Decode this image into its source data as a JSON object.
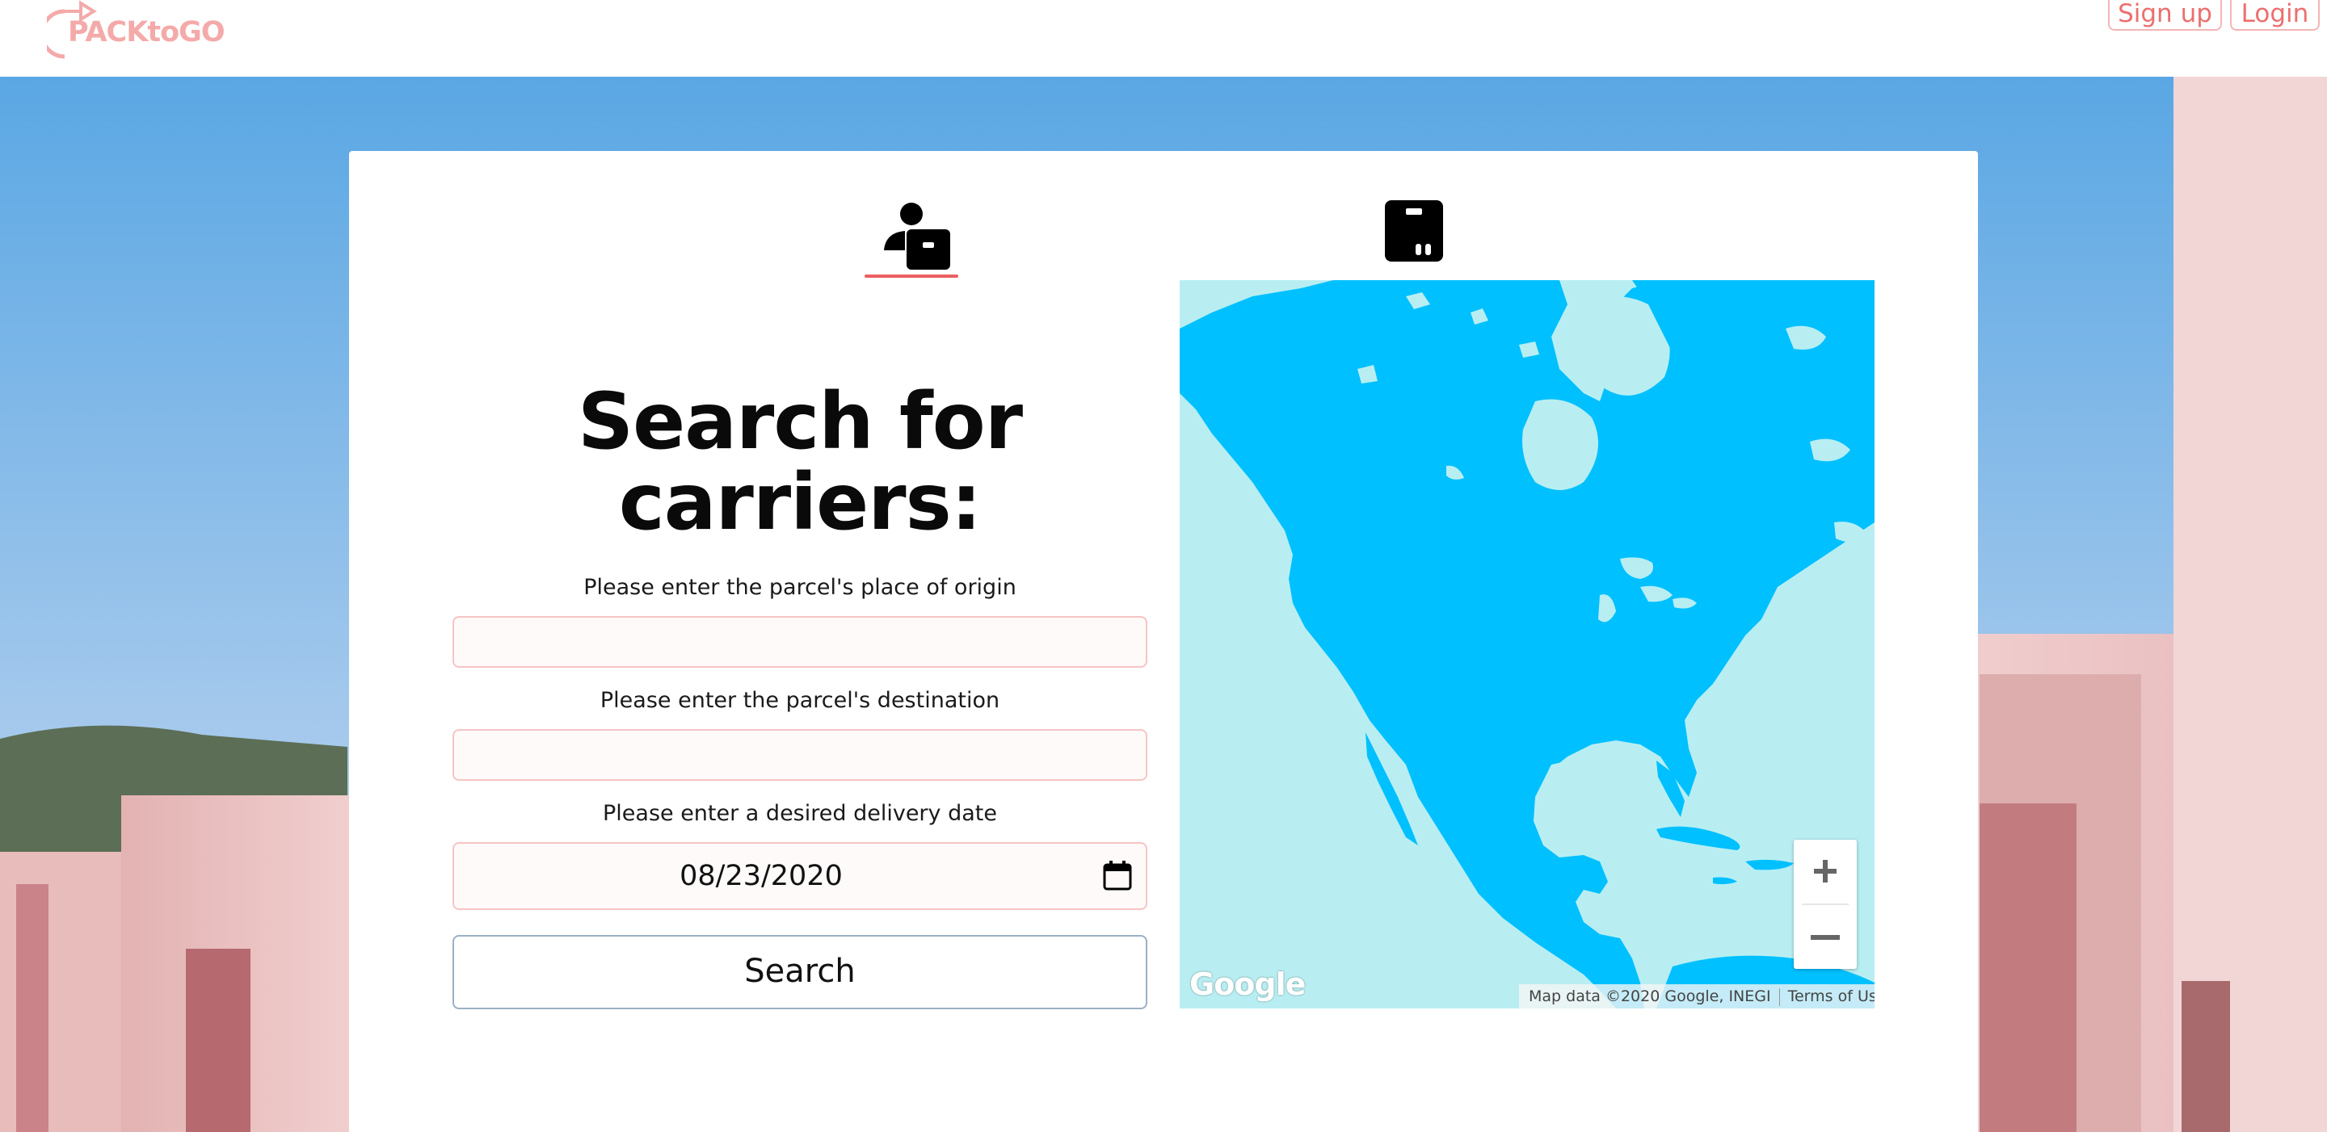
{
  "header": {
    "logo_text": "PACKtoGO",
    "signup_label": "Sign up",
    "login_label": "Login"
  },
  "tabs": [
    {
      "name": "carrier",
      "icon": "carrier-person-icon",
      "active": true
    },
    {
      "name": "parcel",
      "icon": "parcel-box-icon",
      "active": false
    }
  ],
  "form": {
    "title": "Search for carriers:",
    "origin_label": "Please enter the parcel's place of origin",
    "origin_value": "",
    "destination_label": "Please enter the parcel's destination",
    "destination_value": "",
    "date_label": "Please enter a desired delivery date",
    "date_value": "08/23/2020",
    "search_label": "Search"
  },
  "map": {
    "google_logo": "Google",
    "attribution": "Map data ©2020 Google, INEGI",
    "terms": "Terms of Use",
    "zoom_in": "+",
    "zoom_out": "−"
  },
  "colors": {
    "accent": "#ec5f5f",
    "logo": "#f4aaaa",
    "land": "#00c0ff",
    "water": "#b8eef2"
  }
}
